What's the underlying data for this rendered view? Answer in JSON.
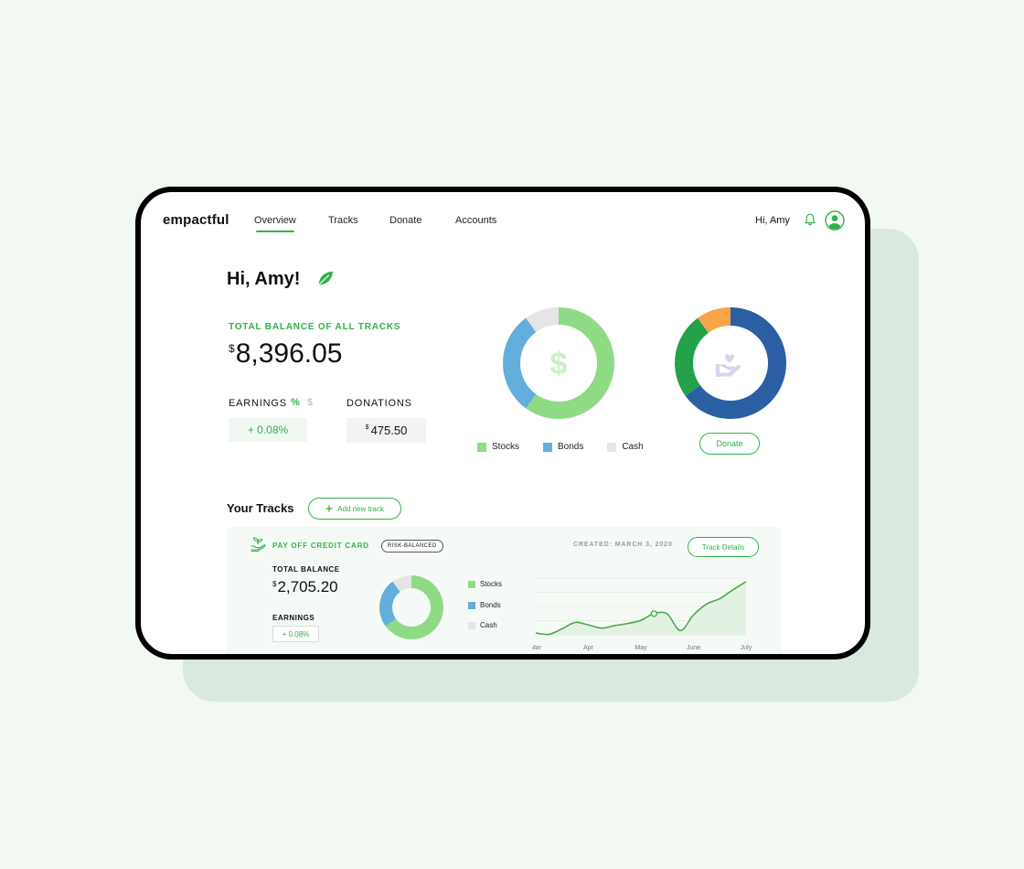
{
  "app": {
    "logo": "empactful"
  },
  "nav": {
    "items": [
      {
        "label": "Overview",
        "active": true
      },
      {
        "label": "Tracks",
        "active": false
      },
      {
        "label": "Donate",
        "active": false
      },
      {
        "label": "Accounts",
        "active": false
      }
    ],
    "greeting": "Hi, Amy",
    "bell_icon": "bell-icon",
    "avatar_icon": "user-avatar-icon"
  },
  "overview": {
    "greeting": "Hi, Amy!",
    "greeting_icon": "leaf-icon",
    "total_balance_label": "TOTAL BALANCE OF ALL TRACKS",
    "currency_symbol": "$",
    "total_balance_value": "8,396.05",
    "earnings_label": "EARNINGS",
    "earnings_toggle_percent": "%",
    "earnings_toggle_dollar": "$",
    "earnings_value": "+ 0.08%",
    "donations_label": "DONATIONS",
    "donations_value": "475.50",
    "donate_button": "Donate",
    "allocation_center_icon": "dollar-icon",
    "donation_center_icon": "heart-hand-icon"
  },
  "tracks": {
    "title": "Your Tracks",
    "add_button": "Add new track",
    "add_icon": "plus-icon",
    "items": [
      {
        "icon": "plant-hand-icon",
        "name": "PAY OFF CREDIT CARD",
        "badge": "RISK-BALANCED",
        "created": "CREATED: MARCH 3, 2020",
        "details_button": "Track Details",
        "total_balance_label": "TOTAL BALANCE",
        "total_balance_value": "2,705.20",
        "earnings_label": "EARNINGS",
        "earnings_value": "+ 0.08%"
      }
    ]
  },
  "colors": {
    "accent": "#31b24a",
    "stocks": "#8fdb85",
    "bonds": "#63aedb",
    "cash": "#e5e5e5",
    "donation_blue": "#2b5fa3",
    "donation_green": "#23a14b",
    "donation_orange": "#f8a448"
  },
  "chart_data": [
    {
      "type": "pie",
      "legend": [
        "Stocks",
        "Bonds",
        "Cash"
      ],
      "values": [
        60,
        30,
        10
      ],
      "colors": [
        "#8fdb85",
        "#63aedb",
        "#e5e5e5"
      ]
    },
    {
      "type": "pie",
      "values": [
        65,
        25,
        10
      ],
      "colors": [
        "#2b5fa3",
        "#23a14b",
        "#f8a448"
      ]
    },
    {
      "type": "pie",
      "legend": [
        "Stocks",
        "Bonds",
        "Cash"
      ],
      "values": [
        65,
        25,
        10
      ],
      "colors": [
        "#8fdb85",
        "#63aedb",
        "#e5e5e5"
      ]
    },
    {
      "type": "line",
      "categories": [
        "Mar",
        "Apr",
        "May",
        "June",
        "July"
      ],
      "x": [
        0,
        0.25,
        0.5,
        0.75,
        1,
        1.25,
        1.5,
        1.75,
        2,
        2.25,
        2.5,
        2.75,
        3,
        3.25,
        3.5,
        3.75,
        4
      ],
      "y": [
        0.5,
        0.15,
        1.7,
        3.5,
        2.8,
        1.9,
        2.6,
        3.2,
        4.1,
        6.0,
        5.9,
        1.2,
        5.6,
        8.7,
        10.2,
        12.7,
        15.0
      ],
      "highlight_x": 2.25,
      "ylim": [
        0,
        16
      ],
      "grid": true
    }
  ]
}
